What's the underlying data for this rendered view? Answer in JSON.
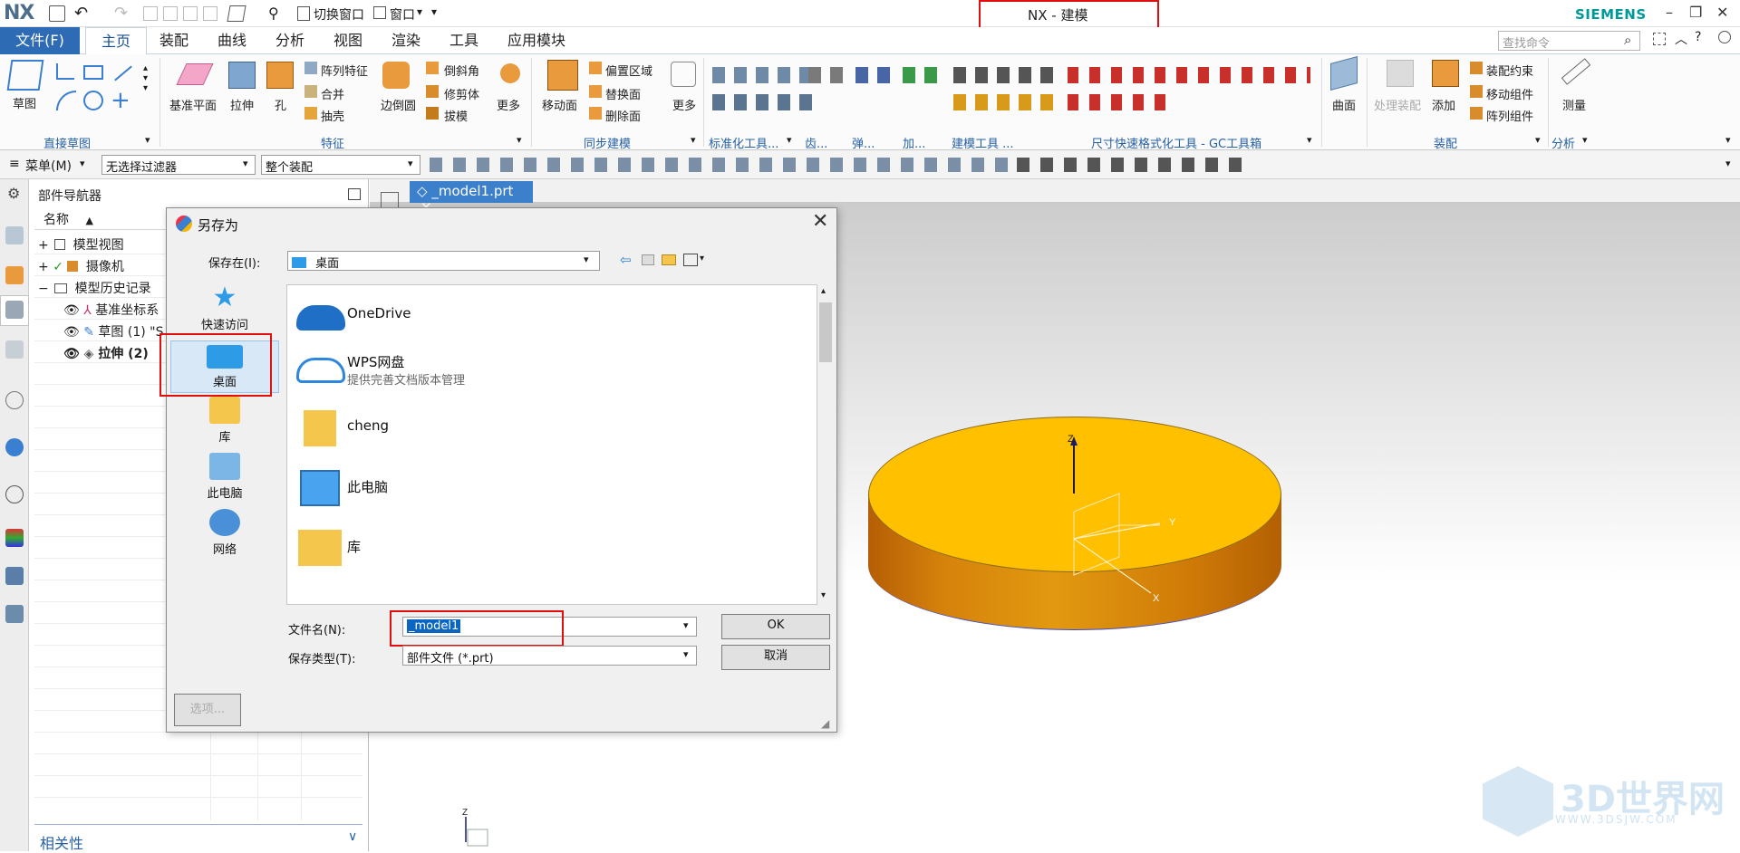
{
  "window": {
    "app_logo": "NX",
    "title": "NX - 建模",
    "brand": "SIEMENS",
    "switch_window": "切换窗口",
    "window_menu": "窗口"
  },
  "menu": {
    "file": "文件(F)",
    "tabs": [
      "主页",
      "装配",
      "曲线",
      "分析",
      "视图",
      "渲染",
      "工具",
      "应用模块"
    ],
    "search_placeholder": "查找命令"
  },
  "ribbon": {
    "sketch": "草图",
    "direct_sketch_group": "直接草图",
    "datum_plane": "基准平面",
    "extrude": "拉伸",
    "hole": "孔",
    "pattern_feature": "阵列特征",
    "unite": "合并",
    "shell": "抽壳",
    "edge_blend": "边倒圆",
    "chamfer": "倒斜角",
    "trim_body": "修剪体",
    "draft": "拔模",
    "more": "更多",
    "feature_group": "特征",
    "move_face": "移动面",
    "offset_region": "偏置区域",
    "replace_face": "替换面",
    "delete_face": "删除面",
    "more2": "更多",
    "sync_group": "同步建模",
    "std_tools": "标准化工具...",
    "gear": "齿...",
    "spring": "弹...",
    "add": "加...",
    "modeling_tools": "建模工具 ...",
    "dim_group": "尺寸快速格式化工具 - GC工具箱",
    "surface": "曲面",
    "process_assembly": "处理装配",
    "add_component": "添加",
    "assembly_constraint": "装配约束",
    "move_component": "移动组件",
    "pattern_component": "阵列组件",
    "assembly_group": "装配",
    "measure": "测量",
    "analysis_group": "分析"
  },
  "toolbar2": {
    "menu_label": "菜单(M)",
    "filter": "无选择过滤器",
    "scope": "整个装配"
  },
  "navigator": {
    "title": "部件导航器",
    "col_name": "名称",
    "nodes": [
      "模型视图",
      "摄像机",
      "模型历史记录",
      "基准坐标系",
      "草图 (1) \"S",
      "拉伸 (2)"
    ],
    "relevance": "相关性"
  },
  "doc_tab": "_model1.prt",
  "dialog": {
    "title": "另存为",
    "save_in_label": "保存在(I):",
    "save_in_value": "桌面",
    "places": [
      "快速访问",
      "桌面",
      "库",
      "此电脑",
      "网络"
    ],
    "files": [
      {
        "name": "OneDrive",
        "sub": ""
      },
      {
        "name": "WPS网盘",
        "sub": "提供完善文档版本管理"
      },
      {
        "name": "cheng",
        "sub": ""
      },
      {
        "name": "此电脑",
        "sub": ""
      },
      {
        "name": "库",
        "sub": ""
      }
    ],
    "filename_label": "文件名(N):",
    "filename_value": "_model1",
    "filetype_label": "保存类型(T):",
    "filetype_value": "部件文件 (*.prt)",
    "ok": "OK",
    "cancel": "取消",
    "options": "选项..."
  },
  "csys": {
    "z": "Z",
    "y": "Y",
    "x": "X"
  },
  "watermark": {
    "main": "3D世界网",
    "url": "WWW.3DSJW.COM"
  },
  "colors": {
    "accent": "#2d6bb4",
    "highlight": "#e10e0e",
    "part": "#ffc000"
  }
}
